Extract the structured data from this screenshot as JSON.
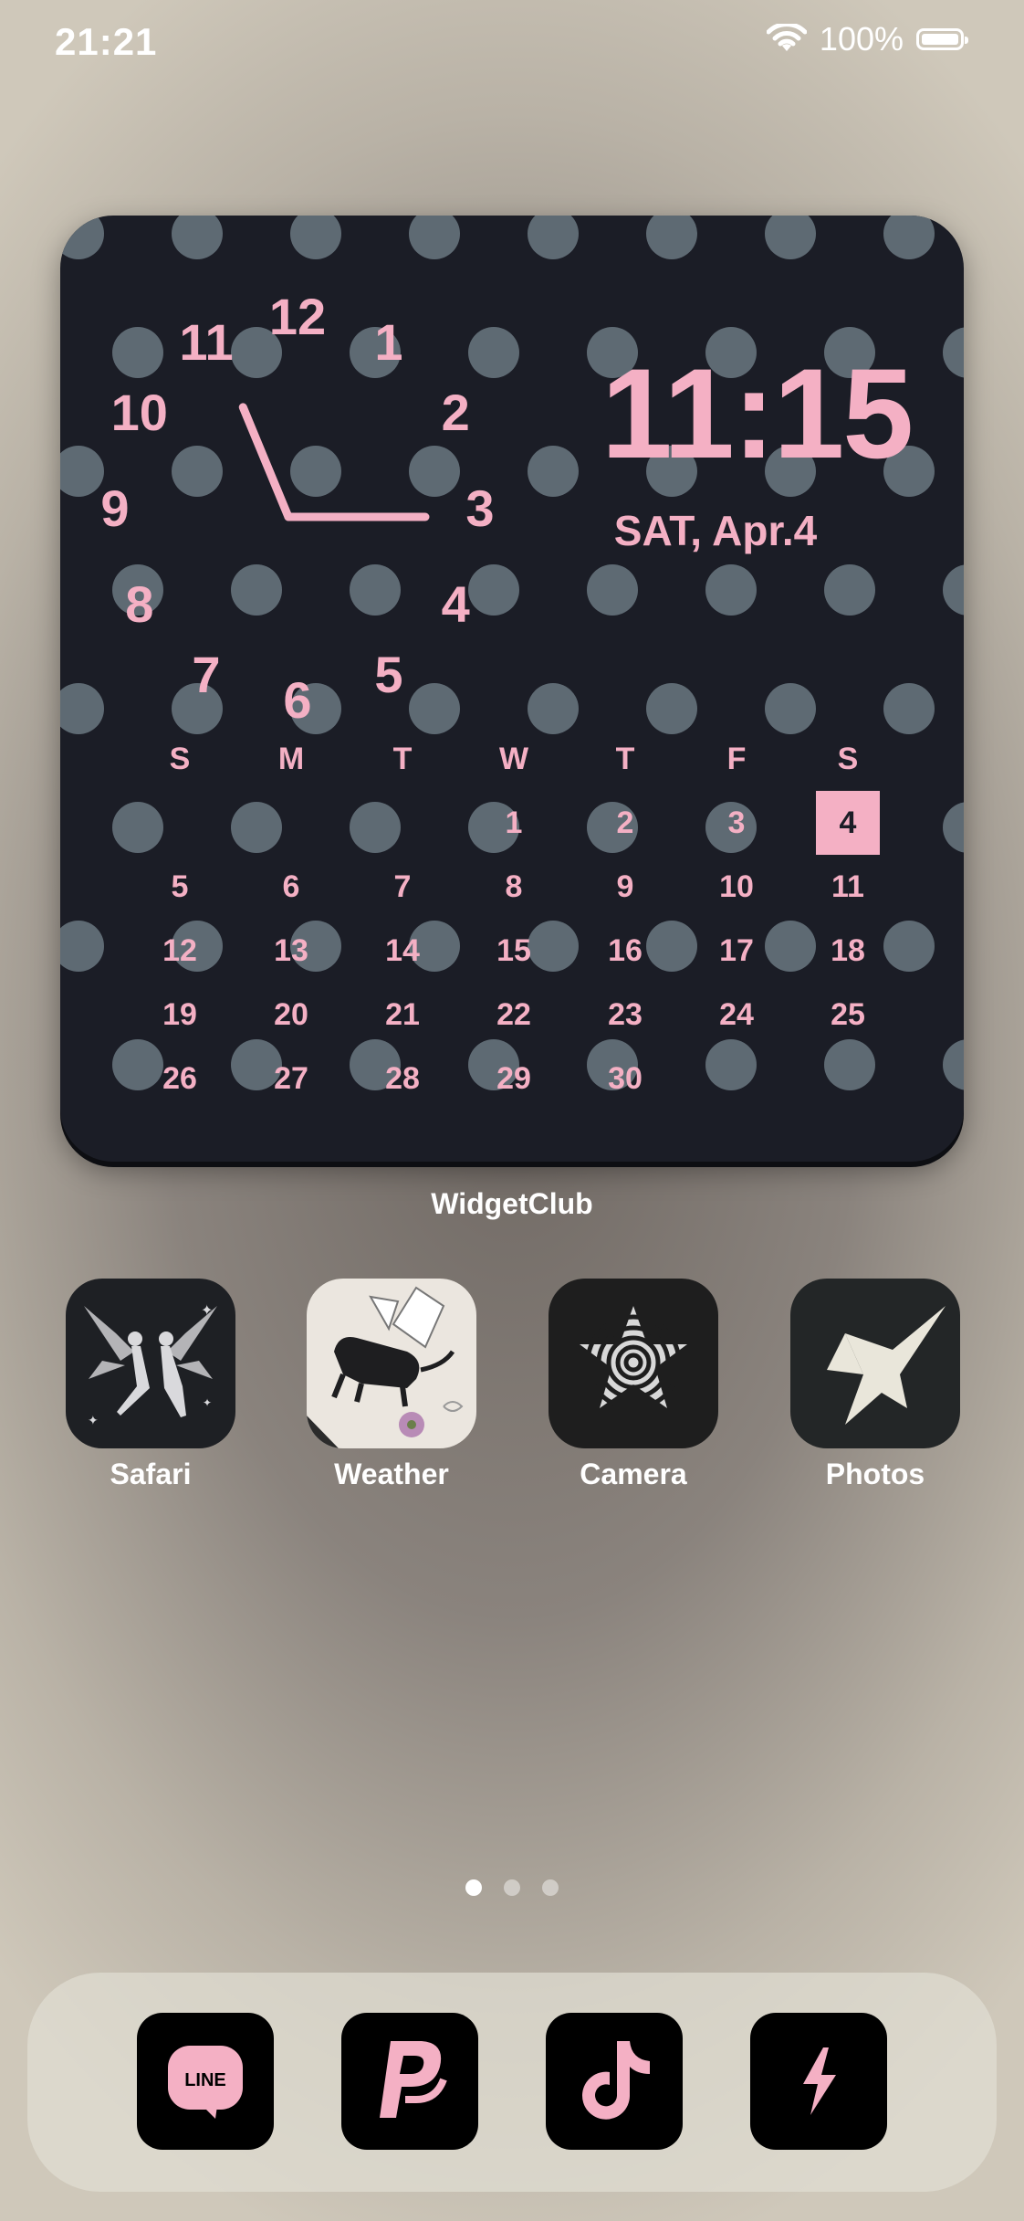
{
  "status_bar": {
    "time": "21:21",
    "battery_percent": "100%",
    "battery_level": 1.0
  },
  "widget": {
    "digital_time": "11:15",
    "date": "SAT, Apr.4",
    "dial": [
      "12",
      "1",
      "2",
      "3",
      "4",
      "5",
      "6",
      "7",
      "8",
      "9",
      "10",
      "11"
    ],
    "analog": {
      "hour": 11,
      "minute": 15
    },
    "calendar": {
      "weekdays": [
        "S",
        "M",
        "T",
        "W",
        "T",
        "F",
        "S"
      ],
      "weeks": [
        [
          "",
          "",
          "",
          "1",
          "2",
          "3",
          "4"
        ],
        [
          "5",
          "6",
          "7",
          "8",
          "9",
          "10",
          "11"
        ],
        [
          "12",
          "13",
          "14",
          "15",
          "16",
          "17",
          "18"
        ],
        [
          "19",
          "20",
          "21",
          "22",
          "23",
          "24",
          "25"
        ],
        [
          "26",
          "27",
          "28",
          "29",
          "30",
          "",
          ""
        ]
      ],
      "today": "4"
    },
    "label": "WidgetClub"
  },
  "apps": [
    {
      "label": "Safari",
      "icon": "fairies-icon"
    },
    {
      "label": "Weather",
      "icon": "cat-fairy-icon"
    },
    {
      "label": "Camera",
      "icon": "spiral-star-icon"
    },
    {
      "label": "Photos",
      "icon": "lightning-star-icon"
    }
  ],
  "pager": {
    "pages": 3,
    "active": 1
  },
  "dock": [
    {
      "name": "line-icon",
      "text": "LINE"
    },
    {
      "name": "paypal-icon"
    },
    {
      "name": "tiktok-icon"
    },
    {
      "name": "bolt-icon"
    }
  ],
  "colors": {
    "accent_pink": "#f4b0c4",
    "widget_bg": "#1b1d26",
    "dot_color": "#5e6a73"
  }
}
